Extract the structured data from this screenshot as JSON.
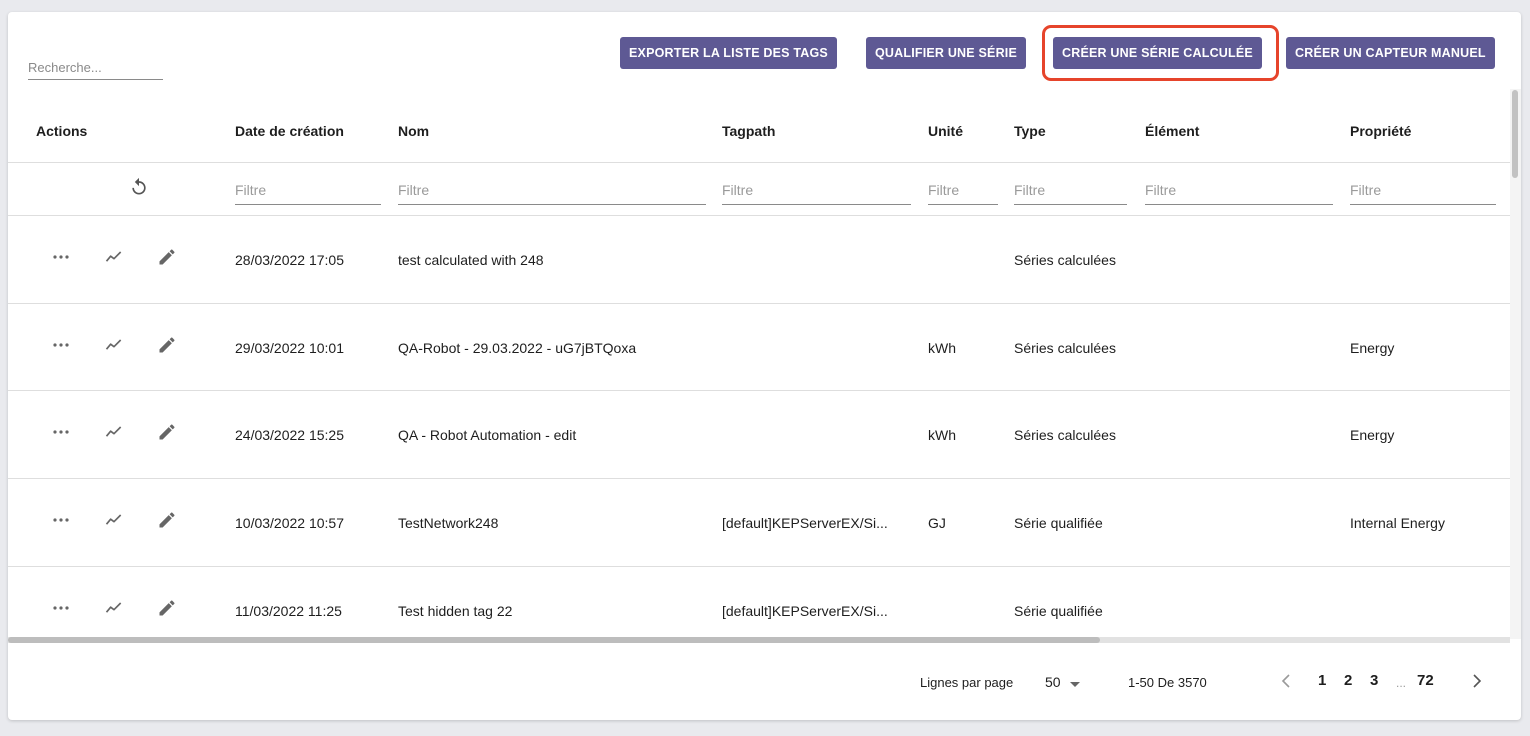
{
  "search": {
    "placeholder": "Recherche..."
  },
  "toolbar": {
    "export_label": "EXPORTER LA LISTE DES TAGS",
    "qualify_label": "QUALIFIER UNE SÉRIE",
    "create_calc_label": "CRÉER UNE SÉRIE CALCULÉE",
    "create_manual_label": "CRÉER UN CAPTEUR MANUEL",
    "button_color": "#5e5994",
    "highlight_color": "#e6442b"
  },
  "table": {
    "headers": {
      "actions": "Actions",
      "date": "Date de création",
      "nom": "Nom",
      "tagpath": "Tagpath",
      "unite": "Unité",
      "type": "Type",
      "element": "Élément",
      "propriete": "Propriété"
    },
    "filter_placeholder": "Filtre",
    "rows": [
      {
        "date": "28/03/2022 17:05",
        "nom": "test calculated with 248",
        "tagpath": "",
        "unite": "",
        "type": "Séries calculées",
        "element": "",
        "propriete": ""
      },
      {
        "date": "29/03/2022 10:01",
        "nom": "QA-Robot - 29.03.2022 - uG7jBTQoxa",
        "tagpath": "",
        "unite": "kWh",
        "type": "Séries calculées",
        "element": "",
        "propriete": "Energy"
      },
      {
        "date": "24/03/2022 15:25",
        "nom": "QA - Robot Automation - edit",
        "tagpath": "",
        "unite": "kWh",
        "type": "Séries calculées",
        "element": "",
        "propriete": "Energy"
      },
      {
        "date": "10/03/2022 10:57",
        "nom": "TestNetwork248",
        "tagpath": "[default]KEPServerEX/Si...",
        "unite": "GJ",
        "type": "Série qualifiée",
        "element": "",
        "propriete": "Internal Energy"
      },
      {
        "date": "11/03/2022 11:25",
        "nom": "Test hidden tag 22",
        "tagpath": "[default]KEPServerEX/Si...",
        "unite": "",
        "type": "Série qualifiée",
        "element": "",
        "propriete": ""
      }
    ]
  },
  "footer": {
    "rows_per_page_label": "Lignes par page",
    "rows_per_page_value": "50",
    "range_text": "1-50 De 3570",
    "pages": [
      "1",
      "2",
      "3"
    ],
    "ellipsis": "...",
    "last_page": "72"
  },
  "icons": {
    "reset": "reset-icon",
    "more": "more-horizontal-icon",
    "chart": "chart-line-icon",
    "edit": "edit-pencil-icon",
    "dropdown": "dropdown-arrow-icon",
    "prev": "chevron-left-icon",
    "next": "chevron-right-icon"
  }
}
